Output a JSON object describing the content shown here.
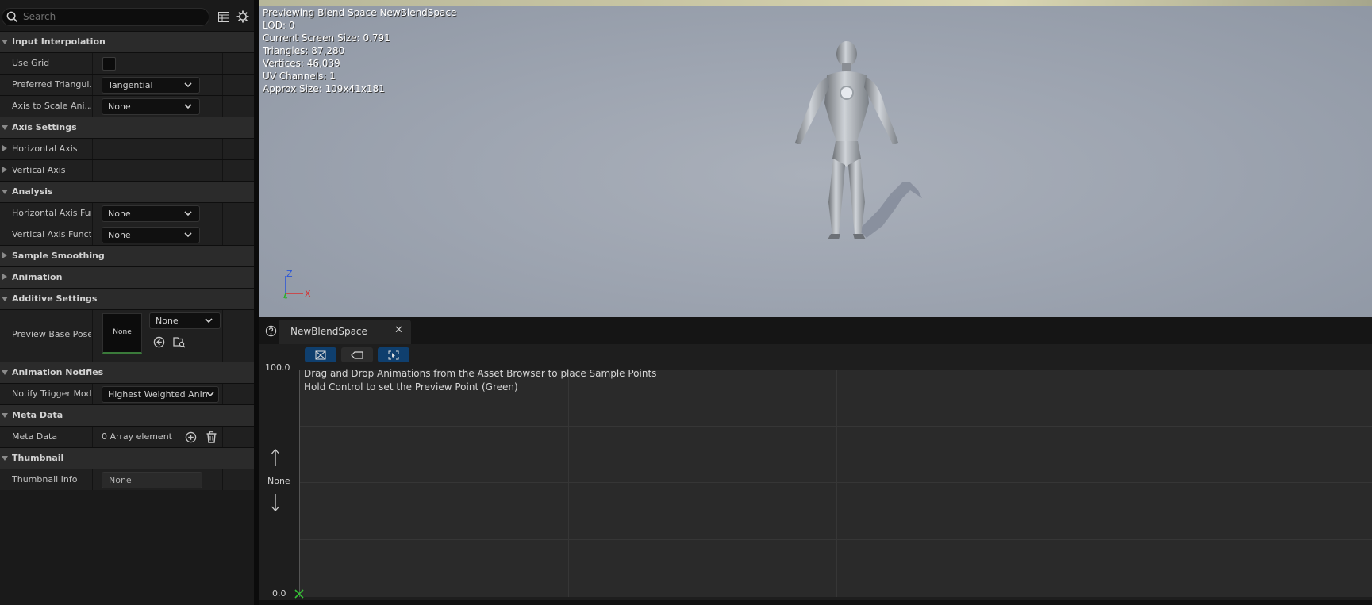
{
  "search": {
    "placeholder": "Search"
  },
  "details": {
    "categories": {
      "input_interpolation": "Input Interpolation",
      "axis_settings": "Axis Settings",
      "analysis": "Analysis",
      "sample_smoothing": "Sample Smoothing",
      "animation": "Animation",
      "additive_settings": "Additive Settings",
      "animation_notifies": "Animation Notifies",
      "meta_data": "Meta Data",
      "thumbnail": "Thumbnail"
    },
    "props": {
      "use_grid": {
        "label": "Use Grid",
        "checked": false
      },
      "preferred_triangulation": {
        "label": "Preferred Triangul...",
        "value": "Tangential"
      },
      "axis_to_scale": {
        "label": "Axis to Scale Ani...",
        "value": "None"
      },
      "horizontal_axis": {
        "label": "Horizontal Axis"
      },
      "vertical_axis": {
        "label": "Vertical Axis"
      },
      "horizontal_axis_function": {
        "label": "Horizontal Axis Func",
        "value": "None"
      },
      "vertical_axis_function": {
        "label": "Vertical Axis Functic",
        "value": "None"
      },
      "preview_base_pose": {
        "label": "Preview Base Pose",
        "thumb": "None",
        "value": "None"
      },
      "notify_trigger_mode": {
        "label": "Notify Trigger Mode",
        "value": "Highest Weighted Anin"
      },
      "meta_data": {
        "label": "Meta Data",
        "value": "0 Array element"
      },
      "thumbnail_info": {
        "label": "Thumbnail Info",
        "value": "None"
      }
    }
  },
  "viewport": {
    "lines": [
      "Previewing Blend Space NewBlendSpace",
      "LOD: 0",
      "Current Screen Size: 0.791",
      "Triangles: 87,280",
      "Vertices: 46,039",
      "UV Channels: 1",
      "Approx Size: 109x41x181"
    ],
    "axes": {
      "z": "Z",
      "x": "X",
      "y": "Y"
    }
  },
  "editor": {
    "tab_label": "NewBlendSpace",
    "hint1": "Drag and Drop Animations from the Asset Browser to place Sample Points",
    "hint2": "Hold Control to set the Preview Point (Green)",
    "y_max": "100.0",
    "y_min": "0.0",
    "y_axis_name": "None"
  },
  "colors": {
    "accent_blue": "#0f3f6e",
    "active_green": "#3a7a3a"
  }
}
